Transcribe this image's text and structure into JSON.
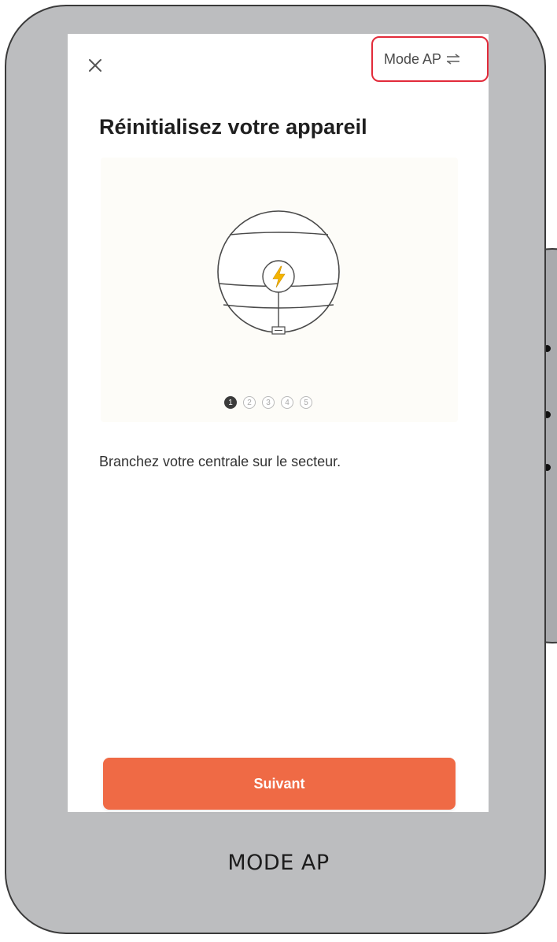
{
  "header": {
    "close_icon": "close-icon",
    "mode_ap_label": "Mode AP",
    "mode_ap_icon": "switch-icon",
    "highlight_color": "#e22b3a"
  },
  "main": {
    "title": "Réinitialisez votre appareil",
    "illustration_icon": "lightning-icon",
    "steps": [
      "1",
      "2",
      "3",
      "4",
      "5"
    ],
    "current_step": 1,
    "instruction": "Branchez votre centrale sur le secteur."
  },
  "footer": {
    "next_label": "Suivant",
    "next_color": "#ef6a45"
  },
  "caption": "MODE AP"
}
